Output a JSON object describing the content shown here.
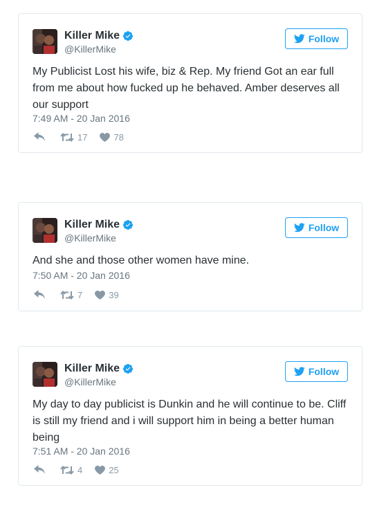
{
  "tweets": [
    {
      "name": "Killer Mike",
      "handle": "@KillerMike",
      "follow_label": "Follow",
      "text": "My Publicist Lost his wife, biz & Rep. My friend Got an ear full from me about how fucked up he behaved.  Amber deserves all our support",
      "timestamp": "7:49 AM - 20 Jan 2016",
      "retweets": "17",
      "likes": "78"
    },
    {
      "name": "Killer Mike",
      "handle": "@KillerMike",
      "follow_label": "Follow",
      "text": "And she and those other women have mine.",
      "timestamp": "7:50 AM - 20 Jan 2016",
      "retweets": "7",
      "likes": "39"
    },
    {
      "name": "Killer Mike",
      "handle": "@KillerMike",
      "follow_label": "Follow",
      "text": "My day to day publicist is Dunkin and he will continue to be.  Cliff is still my friend and i will support him in being a better human being",
      "timestamp": "7:51 AM - 20 Jan 2016",
      "retweets": "4",
      "likes": "25"
    }
  ],
  "colors": {
    "accent": "#1da1f2",
    "verified": "#1da1f2",
    "muted": "#8899a6",
    "text": "#292f33"
  },
  "icons": [
    "verified-badge-icon",
    "twitter-bird-icon",
    "reply-icon",
    "retweet-icon",
    "heart-icon"
  ]
}
